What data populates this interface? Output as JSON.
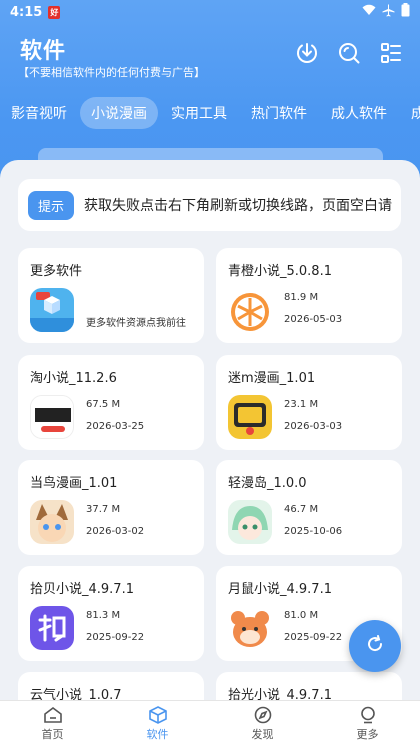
{
  "status": {
    "time": "4:15",
    "badge": "好"
  },
  "header": {
    "title": "软件",
    "subtitle": "【不要相信软件内的任何付费与广告】"
  },
  "tabs": [
    {
      "label": "影音视听",
      "active": false
    },
    {
      "label": "小说漫画",
      "active": true
    },
    {
      "label": "实用工具",
      "active": false
    },
    {
      "label": "热门软件",
      "active": false
    },
    {
      "label": "成人软件",
      "active": false
    },
    {
      "label": "成人",
      "active": false
    }
  ],
  "notice": {
    "button": "提示",
    "text": "获取失败点击右下角刷新或切换线路，页面空白请"
  },
  "cards": [
    {
      "title": "更多软件",
      "desc": "更多软件资源点我前往",
      "icon": "more-software-icon",
      "color": "#4fb3ee"
    },
    {
      "title": "青橙小说_5.0.8.1",
      "size": "81.9 M",
      "date": "2026-05-03",
      "icon": "orange-icon",
      "color": "#f7953a"
    },
    {
      "title": "淘小说_11.2.6",
      "size": "67.5 M",
      "date": "2026-03-25",
      "icon": "taoxiaoshuo-icon",
      "color": "#ffffff"
    },
    {
      "title": "迷m漫画_1.01",
      "size": "23.1 M",
      "date": "2026-03-03",
      "icon": "mimanhua-icon",
      "color": "#f3c533"
    },
    {
      "title": "当鸟漫画_1.01",
      "size": "37.7 M",
      "date": "2026-03-02",
      "icon": "danniao-icon",
      "color": "#a06a3b"
    },
    {
      "title": "轻漫岛_1.0.0",
      "size": "46.7 M",
      "date": "2025-10-06",
      "icon": "qingmandao-icon",
      "color": "#8fd6b2"
    },
    {
      "title": "拾贝小说_4.9.7.1",
      "size": "81.3 M",
      "date": "2025-09-22",
      "icon": "shibei-icon",
      "color": "#6e55e8"
    },
    {
      "title": "月鼠小说_4.9.7.1",
      "size": "81.0 M",
      "date": "2025-09-22",
      "icon": "yueshu-icon",
      "color": "#f08a4b"
    },
    {
      "title": "云气小说_1.0.7",
      "icon": "partial-icon",
      "color": "#4a95ef"
    },
    {
      "title": "拾光小说_4.9.7.1",
      "icon": "partial-icon",
      "color": "#4a95ef"
    }
  ],
  "nav": [
    {
      "label": "首页",
      "active": false,
      "icon": "home-icon"
    },
    {
      "label": "软件",
      "active": true,
      "icon": "cube-icon"
    },
    {
      "label": "发现",
      "active": false,
      "icon": "compass-icon"
    },
    {
      "label": "更多",
      "active": false,
      "icon": "more-icon"
    }
  ],
  "colors": {
    "accent": "#4a95ef",
    "background": "#eef1f6"
  }
}
